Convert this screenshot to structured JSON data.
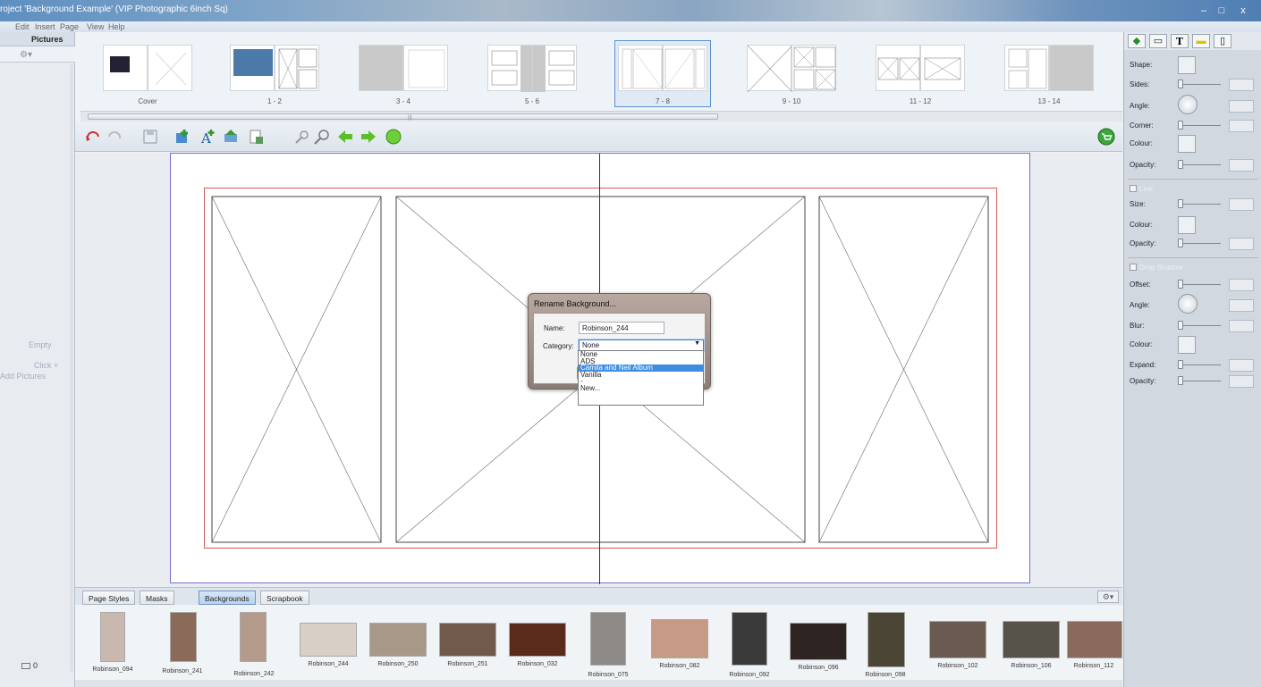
{
  "window": {
    "title": "roject 'Background Example' (VIP Photographic 6inch Sq)",
    "minimize": "‒",
    "maximize": "□",
    "close": "x"
  },
  "menu": [
    "Edit",
    "Insert",
    "Page",
    "View",
    "Help"
  ],
  "left_panel": {
    "header": "Pictures",
    "empty_text": "Empty",
    "click_text": "Click +",
    "add_text": "Add Pictures",
    "count": "0"
  },
  "thumbnails": [
    {
      "label": "Cover"
    },
    {
      "label": "1 - 2"
    },
    {
      "label": "3 - 4"
    },
    {
      "label": "5 - 6"
    },
    {
      "label": "7 - 8"
    },
    {
      "label": "9 - 10"
    },
    {
      "label": "11 - 12"
    },
    {
      "label": "13 - 14"
    }
  ],
  "dialog": {
    "title": "Rename Background...",
    "name_label": "Name:",
    "name_value": "Robinson_244",
    "category_label": "Category:",
    "category_value": "None",
    "options": [
      "None",
      "ADS",
      "Camila and Neil Album",
      "Vanilla",
      "-",
      "New..."
    ]
  },
  "tabs": [
    "Page Styles",
    "Masks",
    "Backgrounds",
    "Scrapbook"
  ],
  "backgrounds": [
    {
      "label": "Robinson_094",
      "color": "#c9b8b0"
    },
    {
      "label": "Robinson_241",
      "color": "#8a6a58"
    },
    {
      "label": "Robinson_242",
      "color": "#b49a8a"
    },
    {
      "label": "Robinson_244",
      "color": "#d8cfc6"
    },
    {
      "label": "Robinson_250",
      "color": "#a89888"
    },
    {
      "label": "Robinson_251",
      "color": "#6f5a4c"
    },
    {
      "label": "Robinson_032",
      "color": "#5a2a1a"
    },
    {
      "label": "Robinson_075",
      "color": "#8d8a87"
    },
    {
      "label": "Robinson_082",
      "color": "#c79a86"
    },
    {
      "label": "Robinson_092",
      "color": "#3a3a3a"
    },
    {
      "label": "Robinson_096",
      "color": "#2e2422"
    },
    {
      "label": "Robinson_098",
      "color": "#4a4535"
    },
    {
      "label": "Robinson_102",
      "color": "#6a5a50"
    },
    {
      "label": "Robinson_106",
      "color": "#57524a"
    },
    {
      "label": "Robinson_112",
      "color": "#8a6a5a"
    }
  ],
  "right_panel": {
    "shape": "Shape:",
    "sides": "Sides:",
    "angle": "Angle:",
    "corner": "Corner:",
    "colour": "Colour:",
    "opacity": "Opacity:",
    "line": "Line",
    "size": "Size:",
    "line_colour": "Colour:",
    "line_opacity": "Opacity:",
    "drop_shadow": "Drop Shadow",
    "offset": "Offset:",
    "shadow_angle": "Angle:",
    "blur": "Blur:",
    "shadow_colour": "Colour:",
    "expand": "Expand:",
    "shadow_opacity": "Opacity:"
  },
  "colors": {
    "accent": "#3d8de0",
    "bleed_line": "#d35a5a",
    "page_border": "#7b6ccf"
  }
}
